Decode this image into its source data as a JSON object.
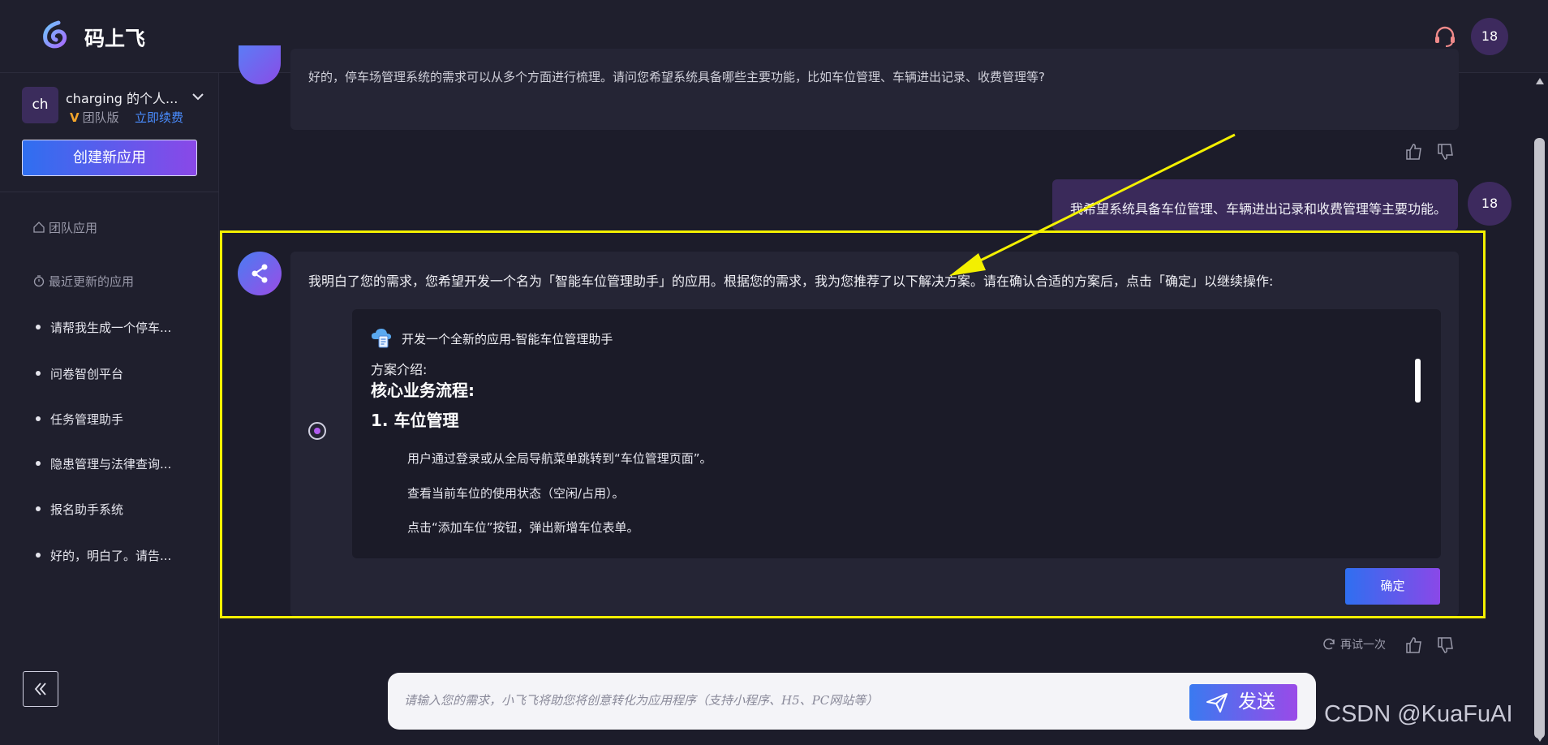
{
  "app": {
    "name": "码上飞"
  },
  "header": {
    "user_avatar": "18",
    "support_icon": "headset-icon"
  },
  "sidebar": {
    "team_avatar": "ch",
    "team_name": "charging 的个人...",
    "edition": "团队版",
    "renew_link": "立即续费",
    "create_button": "创建新应用",
    "section_team_apps": "团队应用",
    "section_recent": "最近更新的应用",
    "recent_items": [
      {
        "label": "请帮我生成一个停车..."
      },
      {
        "label": "问卷智创平台"
      },
      {
        "label": "任务管理助手"
      },
      {
        "label": "隐患管理与法律查询..."
      },
      {
        "label": "报名助手系统"
      },
      {
        "label": "好的，明白了。请告..."
      }
    ]
  },
  "chat": {
    "prev_bot_message": "好的，停车场管理系统的需求可以从多个方面进行梳理。请问您希望系统具备哪些主要功能，比如车位管理、车辆进出记录、收费管理等?",
    "user_message": "我希望系统具备车位管理、车辆进出记录和收费管理等主要功能。",
    "user_avatar": "18",
    "bot_intro": "我明白了您的需求，您希望开发一个名为「智能车位管理助手」的应用。根据您的需求，我为您推荐了以下解决方案。请在确认合适的方案后，点击「确定」以继续操作:",
    "plan": {
      "title": "开发一个全新的应用-智能车位管理助手",
      "intro_label": "方案介绍:",
      "heading": "核心业务流程:",
      "subheading": "1. 车位管理",
      "steps": [
        "用户通过登录或从全局导航菜单跳转到“车位管理页面”。",
        "查看当前车位的使用状态（空闲/占用）。",
        "点击“添加车位”按钮，弹出新增车位表单。"
      ],
      "selected": true
    },
    "confirm_button": "确定",
    "retry_label": "再试一次"
  },
  "input": {
    "placeholder": "请输入您的需求，小飞飞将助您将创意转化为应用程序（支持小程序、H5、PC网站等）",
    "send_label": "发送"
  },
  "annotation": {
    "highlight_color": "#f3f000"
  },
  "watermark": "CSDN @KuaFuAI",
  "colors": {
    "accent_start": "#2f6ff0",
    "accent_end": "#8a48e8",
    "background": "#1c1c2a"
  }
}
